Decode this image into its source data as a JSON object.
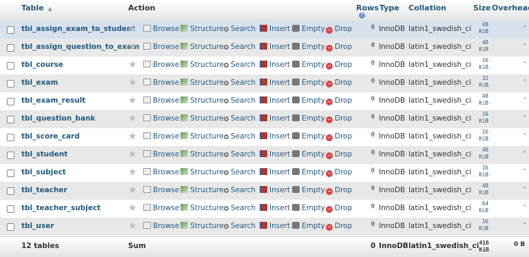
{
  "header": {
    "table": "Table",
    "action": "Action",
    "rows": "Rows",
    "type": "Type",
    "collation": "Collation",
    "size": "Size",
    "overhead": "Overhead"
  },
  "actions": {
    "browse": "Browse",
    "structure": "Structure",
    "search": "Search",
    "insert": "Insert",
    "empty": "Empty",
    "drop": "Drop"
  },
  "tables": [
    {
      "name": "tbl_assign_exam_to_student",
      "rows": "0",
      "type": "InnoDB",
      "collation": "latin1_swedish_ci",
      "size_value": "48",
      "size_unit": "KiB",
      "overhead": "-"
    },
    {
      "name": "tbl_assign_question_to_exam",
      "rows": "0",
      "type": "InnoDB",
      "collation": "latin1_swedish_ci",
      "size_value": "48",
      "size_unit": "KiB",
      "overhead": "-"
    },
    {
      "name": "tbl_course",
      "rows": "0",
      "type": "InnoDB",
      "collation": "latin1_swedish_ci",
      "size_value": "16",
      "size_unit": "KiB",
      "overhead": "-"
    },
    {
      "name": "tbl_exam",
      "rows": "0",
      "type": "InnoDB",
      "collation": "latin1_swedish_ci",
      "size_value": "32",
      "size_unit": "KiB",
      "overhead": "-"
    },
    {
      "name": "tbl_exam_result",
      "rows": "0",
      "type": "InnoDB",
      "collation": "latin1_swedish_ci",
      "size_value": "48",
      "size_unit": "KiB",
      "overhead": "-"
    },
    {
      "name": "tbl_question_bank",
      "rows": "0",
      "type": "InnoDB",
      "collation": "latin1_swedish_ci",
      "size_value": "16",
      "size_unit": "KiB",
      "overhead": "-"
    },
    {
      "name": "tbl_score_card",
      "rows": "0",
      "type": "InnoDB",
      "collation": "latin1_swedish_ci",
      "size_value": "16",
      "size_unit": "KiB",
      "overhead": "-"
    },
    {
      "name": "tbl_student",
      "rows": "0",
      "type": "InnoDB",
      "collation": "latin1_swedish_ci",
      "size_value": "48",
      "size_unit": "KiB",
      "overhead": "-"
    },
    {
      "name": "tbl_subject",
      "rows": "0",
      "type": "InnoDB",
      "collation": "latin1_swedish_ci",
      "size_value": "16",
      "size_unit": "KiB",
      "overhead": "-"
    },
    {
      "name": "tbl_teacher",
      "rows": "0",
      "type": "InnoDB",
      "collation": "latin1_swedish_ci",
      "size_value": "48",
      "size_unit": "KiB",
      "overhead": "-"
    },
    {
      "name": "tbl_teacher_subject",
      "rows": "0",
      "type": "InnoDB",
      "collation": "latin1_swedish_ci",
      "size_value": "64",
      "size_unit": "KiB",
      "overhead": "-"
    },
    {
      "name": "tbl_user",
      "rows": "0",
      "type": "InnoDB",
      "collation": "latin1_swedish_ci",
      "size_value": "16",
      "size_unit": "KiB",
      "overhead": "-"
    }
  ],
  "footer": {
    "count": "12 tables",
    "sum": "Sum",
    "rows": "0",
    "type": "InnoDB",
    "collation": "latin1_swedish_ci",
    "size_value": "416",
    "size_unit": "KiB",
    "overhead_value": "0",
    "overhead_unit": "B"
  },
  "icons": {
    "favorite": "star-icon",
    "browse": "browse-icon",
    "structure": "structure-icon",
    "search": "search-icon",
    "insert": "insert-icon",
    "empty": "empty-icon",
    "drop": "drop-icon"
  },
  "colors": {
    "link": "#235a81",
    "selected_row": "#d7e2ee",
    "alt_row": "#e8e8e8",
    "drop": "#dd4444"
  }
}
